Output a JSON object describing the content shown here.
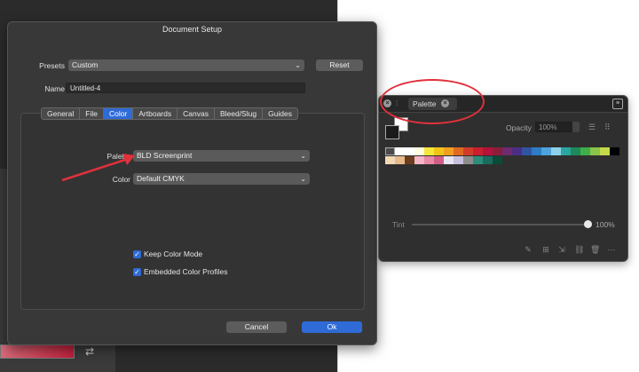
{
  "dialog": {
    "title": "Document Setup",
    "presets_label": "Presets",
    "presets_value": "Custom",
    "reset_label": "Reset",
    "name_label": "Name",
    "name_value": "Untitled-4",
    "tabs": [
      {
        "label": "General",
        "active": false
      },
      {
        "label": "File",
        "active": false
      },
      {
        "label": "Color",
        "active": true
      },
      {
        "label": "Artboards",
        "active": false
      },
      {
        "label": "Canvas",
        "active": false
      },
      {
        "label": "Bleed/Slug",
        "active": false
      },
      {
        "label": "Guides",
        "active": false
      }
    ],
    "palette_label": "Palette",
    "palette_value": "BLD Screenprint",
    "color_label": "Color",
    "color_value": "Default CMYK",
    "keep_color_mode_label": "Keep Color Mode",
    "keep_color_mode_checked": true,
    "embedded_profiles_label": "Embedded Color Profiles",
    "embedded_profiles_checked": true,
    "cancel_label": "Cancel",
    "ok_label": "Ok"
  },
  "palette_panel": {
    "tab_label": "Palette",
    "opacity_label": "Opacity",
    "opacity_value": "100%",
    "tint_label": "Tint",
    "tint_value": "100%",
    "tint_level": 1.0
  },
  "colors": {
    "accent": "#2f6bd6",
    "annotation": "#e0313c"
  },
  "swatches_row1": [
    "#ffffff",
    "#fffbe0",
    "#f5e63a",
    "#f3c418",
    "#f0a020",
    "#e06a22",
    "#d13b2a",
    "#c8202f",
    "#b3123b",
    "#8a1d3a",
    "#6e2a6f",
    "#4b2e83",
    "#3154a3",
    "#2d7cc4",
    "#4da3dc",
    "#8ed0ea",
    "#2aa6a0",
    "#1d8a5a",
    "#3fae4a",
    "#8bc34a",
    "#c5d94a",
    "#000000"
  ],
  "swatches_row2": [
    "#f1d9b5",
    "#e8b98a",
    "#6b3f1e",
    "#f4b6c6",
    "#e88aa6",
    "#d35d86",
    "#e9e4f2",
    "#c7c0dd",
    "#8d8d8d",
    "#2d8c7a",
    "#1b6b5e",
    "#0c4a3a"
  ]
}
